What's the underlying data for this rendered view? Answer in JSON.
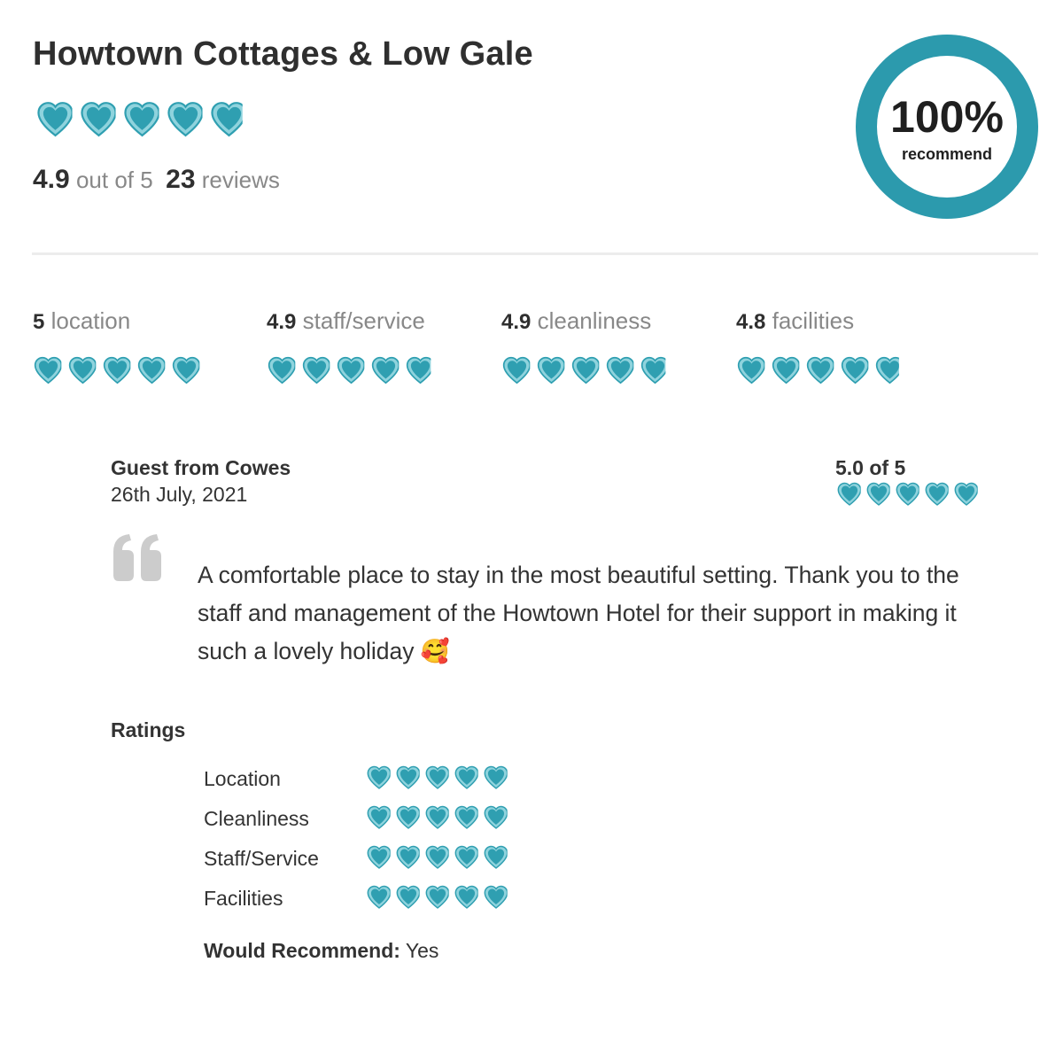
{
  "header": {
    "title": "Howtown Cottages & Low Gale",
    "overall_rating": "4.9",
    "overall_rating_value": 4.9,
    "out_of_text": "out of 5",
    "review_count": "23",
    "reviews_text": "reviews"
  },
  "recommend_badge": {
    "percent": "100%",
    "label": "recommend"
  },
  "categories": [
    {
      "score": "5",
      "score_value": 5,
      "label": "location"
    },
    {
      "score": "4.9",
      "score_value": 4.9,
      "label": "staff/service"
    },
    {
      "score": "4.9",
      "score_value": 4.9,
      "label": "cleanliness"
    },
    {
      "score": "4.8",
      "score_value": 4.8,
      "label": "facilities"
    }
  ],
  "review": {
    "reviewer": "Guest from Cowes",
    "date": "26th July, 2021",
    "score_text": "5.0 of 5",
    "score_value": 5,
    "text": "A comfortable place to stay in the most beautiful setting. Thank you to the staff and management of the Howtown Hotel for their support in making it such a lovely holiday 🥰",
    "ratings_heading": "Ratings",
    "ratings": [
      {
        "label": "Location",
        "value": 5
      },
      {
        "label": "Cleanliness",
        "value": 5
      },
      {
        "label": "Staff/Service",
        "value": 5
      },
      {
        "label": "Facilities",
        "value": 5
      }
    ],
    "would_recommend_label": "Would Recommend:",
    "would_recommend_value": "Yes"
  },
  "icons": {
    "rating_icon": "heart-icon",
    "quote_icon": "quote-icon"
  },
  "colors": {
    "accent": "#2c9aad",
    "heart_fill": "#2f9fb1",
    "heart_highlight": "#8fd3dd",
    "muted_text": "#888888",
    "quote_gray": "#cccccc"
  }
}
